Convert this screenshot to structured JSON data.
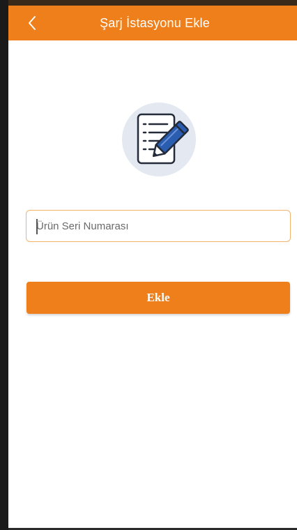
{
  "header": {
    "title": "Şarj İstasyonu Ekle",
    "back_icon": "chevron-left-icon"
  },
  "illustration": {
    "icon": "document-edit-icon"
  },
  "form": {
    "serial_placeholder": "Ürün Seri Numarası",
    "serial_value": ""
  },
  "actions": {
    "add_label": "Ekle"
  },
  "colors": {
    "accent": "#ee7f1b",
    "input_border": "#f0b46d",
    "icon_circle": "#e3e8f1",
    "icon_pen": "#2a5db0"
  }
}
